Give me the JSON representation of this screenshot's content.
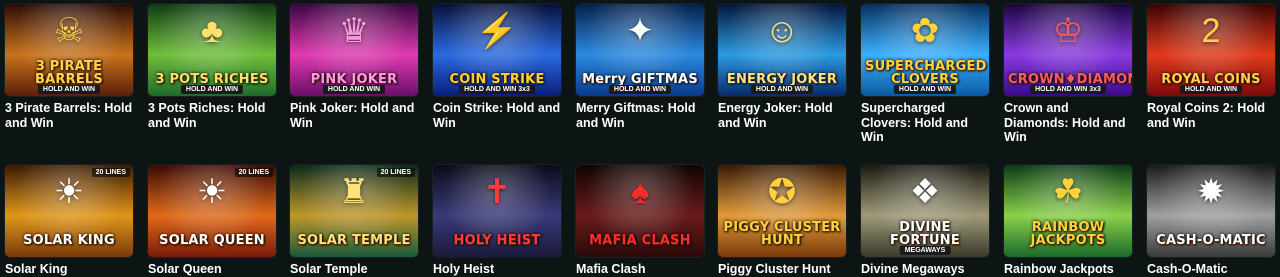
{
  "games": [
    {
      "title": "3 Pirate Barrels: Hold and Win",
      "logo": "3 PIRATE BARRELS",
      "tag": "HOLD AND WIN",
      "emblem": "☠",
      "bg": [
        "#5a1e0a",
        "#c8731c",
        "#2a0c05"
      ],
      "logo_color": "#ffd34d"
    },
    {
      "title": "3 Pots Riches: Hold and Win",
      "logo": "3 POTS RICHES",
      "tag": "HOLD AND WIN",
      "emblem": "♣",
      "bg": [
        "#1f6a2a",
        "#6fbf3a",
        "#0f3a14"
      ],
      "logo_color": "#ffe06a"
    },
    {
      "title": "Pink Joker: Hold and Win",
      "logo": "PINK JOKER",
      "tag": "HOLD AND WIN",
      "emblem": "♛",
      "bg": [
        "#6a0f6a",
        "#e03ab0",
        "#3a0640"
      ],
      "logo_color": "#ff9ae0"
    },
    {
      "title": "Coin Strike: Hold and Win",
      "logo": "COIN STRIKE",
      "tag": "HOLD AND WIN 3x3",
      "emblem": "⚡",
      "bg": [
        "#0a1e7a",
        "#2a6ae0",
        "#06103a"
      ],
      "logo_color": "#ffd12a"
    },
    {
      "title": "Merry Giftmas: Hold and Win",
      "logo": "Merry GIFTMAS",
      "tag": "HOLD AND WIN",
      "emblem": "✦",
      "bg": [
        "#0a3a8a",
        "#2a8ae0",
        "#06204a"
      ],
      "logo_color": "#ffffff"
    },
    {
      "title": "Energy Joker: Hold and Win",
      "logo": "ENERGY JOKER",
      "tag": "HOLD AND WIN",
      "emblem": "☺",
      "bg": [
        "#0a2a6a",
        "#2a9ae0",
        "#04163a"
      ],
      "logo_color": "#ffe27a"
    },
    {
      "title": "Supercharged Clovers: Hold and Win",
      "logo": "SUPERCHARGED CLOVERS",
      "tag": "HOLD AND WIN",
      "emblem": "✿",
      "bg": [
        "#0a5aa0",
        "#3ab0ff",
        "#053060"
      ],
      "logo_color": "#ffd23a"
    },
    {
      "title": "Crown and Diamonds: Hold and Win",
      "logo": "CROWN♦DIAMONDS",
      "tag": "HOLD AND WIN 3x3",
      "emblem": "♔",
      "bg": [
        "#3a0a8a",
        "#8a3ae0",
        "#1a0540"
      ],
      "logo_color": "#ff5a5a"
    },
    {
      "title": "Royal Coins 2: Hold and Win",
      "logo": "ROYAL COINS",
      "tag": "HOLD AND WIN",
      "emblem": "2",
      "bg": [
        "#7a0a0a",
        "#e03a1a",
        "#3a0404"
      ],
      "logo_color": "#ffd24a"
    },
    {
      "title": "Solar King",
      "logo": "SOLAR KING",
      "tag": "",
      "lines": "20 LINES",
      "emblem": "☀",
      "bg": [
        "#7a3a0a",
        "#e0961a",
        "#3a1a04"
      ],
      "logo_color": "#ffffff"
    },
    {
      "title": "Solar Queen",
      "logo": "SOLAR QUEEN",
      "tag": "",
      "lines": "20 LINES",
      "emblem": "☀",
      "bg": [
        "#7a1a0a",
        "#e06a1a",
        "#3a0a04"
      ],
      "logo_color": "#ffffff"
    },
    {
      "title": "Solar Temple",
      "logo": "SOLAR TEMPLE",
      "tag": "",
      "lines": "20 LINES",
      "emblem": "♜",
      "bg": [
        "#1a5a3a",
        "#c0962a",
        "#0a2a1a"
      ],
      "logo_color": "#ffe27a"
    },
    {
      "title": "Holy Heist",
      "logo": "HOLY HEIST",
      "tag": "",
      "emblem": "✝",
      "bg": [
        "#1a1a3a",
        "#3a3a7a",
        "#0a0a1a"
      ],
      "logo_color": "#ff3a3a"
    },
    {
      "title": "Mafia Clash",
      "logo": "MAFIA CLASH",
      "tag": "",
      "emblem": "♠",
      "bg": [
        "#2a0a0a",
        "#6a1a1a",
        "#100404"
      ],
      "logo_color": "#ff2a2a"
    },
    {
      "title": "Piggy Cluster Hunt",
      "logo": "PIGGY CLUSTER HUNT",
      "tag": "",
      "emblem": "✪",
      "bg": [
        "#7a3a0a",
        "#e09a3a",
        "#3a1a04"
      ],
      "logo_color": "#ffd23a"
    },
    {
      "title": "Divine Megaways",
      "logo": "DIVINE FORTUNE",
      "tag": "MEGAWAYS",
      "emblem": "❖",
      "bg": [
        "#3a3a2a",
        "#a09a7a",
        "#1a1a10"
      ],
      "logo_color": "#ffffff"
    },
    {
      "title": "Rainbow Jackpots",
      "logo": "RAINBOW JACKPOTS",
      "tag": "",
      "emblem": "☘",
      "bg": [
        "#1a6a2a",
        "#8ad04a",
        "#0a3a14"
      ],
      "logo_color": "#ffd23a"
    },
    {
      "title": "Cash-O-Matic",
      "logo": "CASH-O-MATIC",
      "tag": "",
      "emblem": "✹",
      "bg": [
        "#3a3a3a",
        "#a0a0a0",
        "#1a1a1a"
      ],
      "logo_color": "#ffffff"
    }
  ]
}
